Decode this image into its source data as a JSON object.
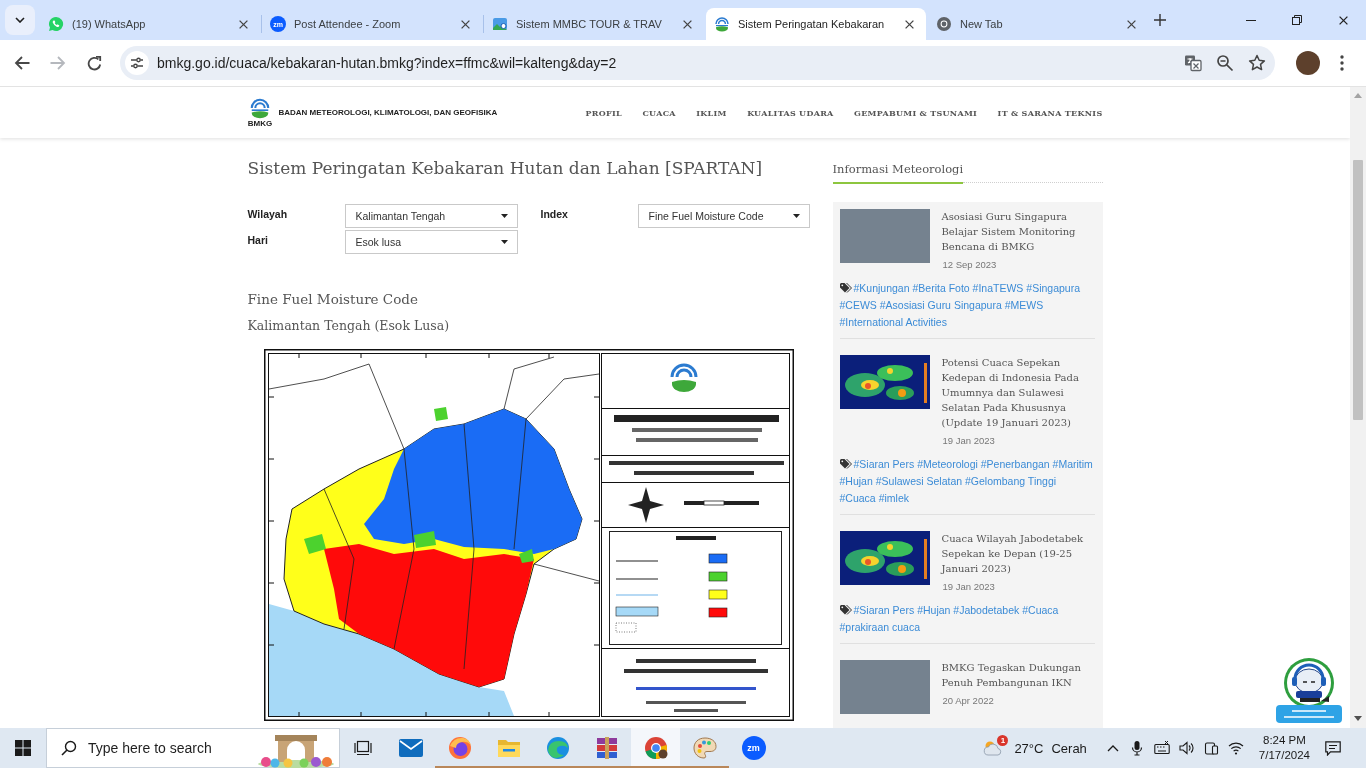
{
  "browser": {
    "tabs": [
      {
        "kind": "whatsapp",
        "title": "(19) WhatsApp",
        "selected": false
      },
      {
        "kind": "zoom",
        "icon_text": "zm",
        "title": "Post Attendee - Zoom",
        "selected": false
      },
      {
        "kind": "image",
        "title": "Sistem MMBC TOUR & TRAV",
        "selected": false
      },
      {
        "kind": "bmkg",
        "title": "Sistem Peringatan Kebakaran",
        "selected": true
      },
      {
        "kind": "chrome",
        "title": "New Tab",
        "selected": false
      }
    ],
    "nav_buttons": [
      {
        "kind": "back",
        "disabled": false
      },
      {
        "kind": "forward",
        "disabled": true
      },
      {
        "kind": "reload",
        "disabled": false
      }
    ],
    "address": "bmkg.go.id/cuaca/kebakaran-hutan.bmkg?index=ffmc&wil=kalteng&day=2"
  },
  "site_header": {
    "logo_text": "BMKG",
    "org_name": "BADAN METEOROLOGI, KLIMATOLOGI, DAN GEOFISIKA",
    "nav": [
      "PROFIL",
      "CUACA",
      "IKLIM",
      "KUALITAS UDARA",
      "GEMPABUMI & TSUNAMI",
      "IT & SARANA TEKNIS"
    ]
  },
  "main": {
    "title": "Sistem Peringatan Kebakaran Hutan dan Lahan [SPARTAN]",
    "filters": [
      {
        "label": "Wilayah",
        "value": "Kalimantan Tengah"
      },
      {
        "label": "Index",
        "value": "Fine Fuel Moisture Code"
      },
      {
        "label": "Hari",
        "value": "Esok lusa"
      }
    ],
    "map_title": "Fine Fuel Moisture Code",
    "map_subtitle": "Kalimantan Tengah (Esok Lusa)"
  },
  "sidebar": {
    "heading": "Informasi Meteorologi",
    "articles": [
      {
        "kind": "photo",
        "title": "Asosiasi Guru Singapura Belajar Sistem Monitoring Bencana di BMKG",
        "date": "12 Sep 2023",
        "tags": [
          "#Kunjungan",
          "#Berita Foto",
          "#InaTEWS",
          "#Singapura",
          "#CEWS",
          "#Asosiasi Guru Singapura",
          "#MEWS",
          "#International Activities"
        ]
      },
      {
        "kind": "weather-map",
        "title": "Potensi Cuaca Sepekan Kedepan di Indonesia Pada Umumnya dan Sulawesi Selatan Pada Khususnya (Update 19 Januari 2023)",
        "date": "19 Jan 2023",
        "tags": [
          "#Siaran Pers",
          "#Meteorologi",
          "#Penerbangan",
          "#Maritim",
          "#Hujan",
          "#Sulawesi Selatan",
          "#Gelombang Tinggi",
          "#Cuaca",
          "#imlek"
        ]
      },
      {
        "kind": "weather-map",
        "title": "Cuaca Wilayah Jabodetabek Sepekan ke Depan (19-25 Januari 2023)",
        "date": "19 Jan 2023",
        "tags": [
          "#Siaran Pers",
          "#Hujan",
          "#Jabodetabek",
          "#Cuaca",
          "#prakiraan cuaca"
        ]
      },
      {
        "kind": "photo",
        "title": "BMKG Tegaskan Dukungan Penuh Pembangunan IKN",
        "date": "20 Apr 2022"
      }
    ]
  },
  "taskbar": {
    "search": {
      "placeholder": "Type here to search"
    },
    "apps": [
      {
        "kind": "mail",
        "running": false,
        "selected": false
      },
      {
        "kind": "firefox",
        "running": true,
        "selected": false
      },
      {
        "kind": "files",
        "running": true,
        "selected": false
      },
      {
        "kind": "edge",
        "running": true,
        "selected": false
      },
      {
        "kind": "archive",
        "running": true,
        "selected": false
      },
      {
        "kind": "chrome",
        "running": true,
        "selected": true
      },
      {
        "kind": "paint",
        "running": true,
        "selected": false
      },
      {
        "kind": "zoom",
        "icon_text": "zm",
        "running": false,
        "selected": false
      }
    ],
    "weather": {
      "badge": "1",
      "temperature": "27°C",
      "condition": "Cerah"
    },
    "clock": {
      "time": "8:24 PM",
      "date": "7/17/2024"
    }
  }
}
